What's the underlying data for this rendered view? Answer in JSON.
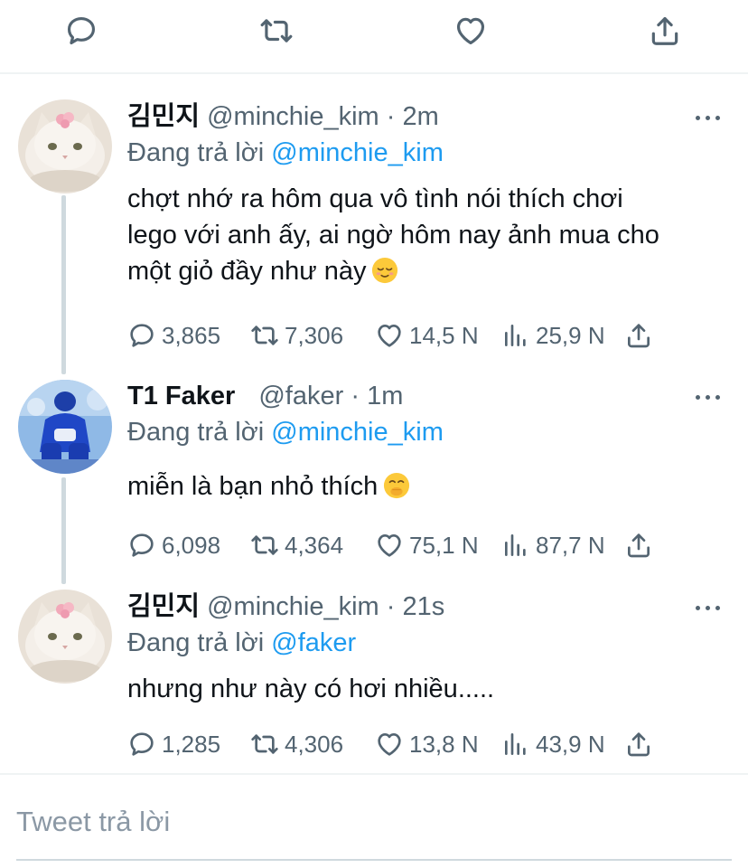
{
  "top_actions": {
    "icons": [
      "reply-icon",
      "retweet-icon",
      "like-icon",
      "share-icon"
    ]
  },
  "tweets": [
    {
      "display_name": "김민지",
      "handle": "@minchie_kim",
      "separator": "·",
      "time": "2m",
      "replying_prefix": "Đang trả lời",
      "replying_to": "@minchie_kim",
      "lines": [
        "chợt nhớ ra hôm qua vô tình nói thích chơi",
        "lego với anh ấy, ai ngờ hôm nay ảnh mua cho",
        "một giỏ đầy như này"
      ],
      "emoji": "relieved-face",
      "replies": "3,865",
      "retweets": "7,306",
      "likes": "14,5 N",
      "views": "25,9 N"
    },
    {
      "display_name": "T1 Faker",
      "handle": "@faker",
      "separator": "·",
      "time": "1m",
      "replying_prefix": "Đang trả lời",
      "replying_to": "@minchie_kim",
      "lines": [
        "miễn là bạn nhỏ thích"
      ],
      "emoji": "hand-over-mouth-face",
      "replies": "6,098",
      "retweets": "4,364",
      "likes": "75,1 N",
      "views": "87,7 N"
    },
    {
      "display_name": "김민지",
      "handle": "@minchie_kim",
      "separator": "·",
      "time": "21s",
      "replying_prefix": "Đang trả lời",
      "replying_to": "@faker",
      "lines": [
        "nhưng như này có hơi nhiều....."
      ],
      "replies": "1,285",
      "retweets": "4,306",
      "likes": "13,8 N",
      "views": "43,9 N"
    }
  ],
  "reply_box": {
    "placeholder": "Tweet trả lời"
  },
  "colors": {
    "text": "#0f1419",
    "muted": "#536471",
    "link": "#1d9bf0",
    "divider": "#eff3f4"
  }
}
